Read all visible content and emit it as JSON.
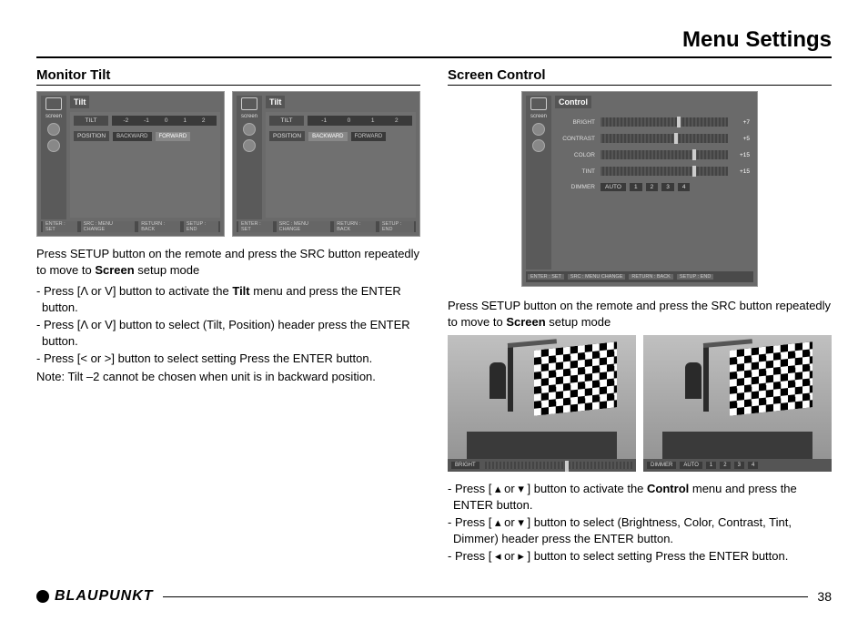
{
  "page_title": "Menu Settings",
  "left": {
    "heading": "Monitor Tilt",
    "shot": {
      "title": "Tilt",
      "side_label": "screen",
      "tilt_label": "TILT",
      "tilt_values": [
        "-2",
        "-1",
        "0",
        "1",
        "2"
      ],
      "position_label": "POSITION",
      "position_options": {
        "backward": "BACKWARD",
        "forward": "FORWARD"
      },
      "footer": {
        "enter": "ENTER : SET",
        "src": "SRC : MENU CHANGE",
        "return": "RETURN : BACK",
        "setup": "SETUP : END"
      }
    },
    "p_intro_1": "Press SETUP button on the remote and press the SRC button repeatedly to move to ",
    "p_intro_bold": "Screen",
    "p_intro_2": " setup mode",
    "b1a": "- Press [Λ or V] button to activate the ",
    "b1bold": "Tilt",
    "b1b": " menu and press the ENTER button.",
    "b2": "- Press [Λ or V] button to select (Tilt, Position) header press the ENTER button.",
    "b3": "- Press [< or >] button to select setting Press the ENTER button.",
    "note": "Note: Tilt –2 cannot be chosen when unit is in backward position."
  },
  "right": {
    "heading": "Screen Control",
    "shot": {
      "title": "Control",
      "side_label": "screen",
      "rows": [
        {
          "label": "BRIGHT",
          "value": "+7"
        },
        {
          "label": "CONTRAST",
          "value": "+5"
        },
        {
          "label": "COLOR",
          "value": "+15"
        },
        {
          "label": "TINT",
          "value": "+15"
        }
      ],
      "dimmer_label": "DIMMER",
      "dimmer_opts": [
        "AUTO",
        "1",
        "2",
        "3",
        "4"
      ],
      "footer": {
        "enter": "ENTER : SET",
        "src": "SRC : MENU CHANGE",
        "return": "RETURN : BACK",
        "setup": "SETUP : END"
      }
    },
    "p_intro_1": "Press SETUP button on the remote and press the SRC button repeatedly to move to ",
    "p_intro_bold": "Screen",
    "p_intro_2": " setup mode",
    "photo_left": {
      "label": "BRIGHT"
    },
    "photo_right": {
      "label": "DIMMER",
      "opts": [
        "AUTO",
        "1",
        "2",
        "3",
        "4"
      ]
    },
    "b1a": "- Press [ ",
    "b1mid": " or ",
    "b1b": " ] button to activate the ",
    "b1bold": "Control",
    "b1c": " menu and press the ENTER button.",
    "b2a": "- Press [ ",
    "b2mid": " or ",
    "b2b": " ] button to select (Brightness, Color, Contrast, Tint, Dimmer) header press the ENTER button.",
    "b3a": "- Press [ ",
    "b3mid": " or ",
    "b3b": " ] button to select setting Press the ENTER button."
  },
  "footer": {
    "brand": "BLAUPUNKT",
    "page": "38"
  }
}
